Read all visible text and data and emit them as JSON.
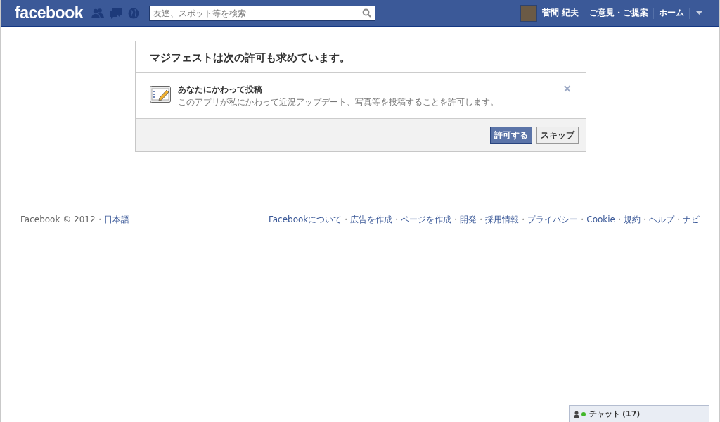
{
  "header": {
    "logo": "facebook",
    "search": {
      "placeholder": "友達、スポット等を検索"
    },
    "user_name": "菅間 紀夫",
    "links": [
      "ご意見・ご提案",
      "ホーム"
    ]
  },
  "dialog": {
    "title": "マジフェストは次の許可も求めています。",
    "permission": {
      "title": "あなたにかわって投稿",
      "description": "このアプリが私にかわって近況アップデート、写真等を投稿することを許可します。",
      "remove": "×"
    },
    "buttons": [
      {
        "label": "許可する",
        "kind": "primary"
      },
      {
        "label": "スキップ",
        "kind": "secondary"
      }
    ]
  },
  "footer": {
    "copyright": "Facebook © 2012",
    "separator": "・",
    "language": "日本語",
    "links": [
      "Facebookについて",
      "広告を作成",
      "ページを作成",
      "開発",
      "採用情報",
      "プライバシー",
      "Cookie",
      "規約",
      "ヘルプ",
      "ナビ"
    ]
  },
  "chat": {
    "label": "チャット",
    "count": "(17)",
    "online": true
  }
}
